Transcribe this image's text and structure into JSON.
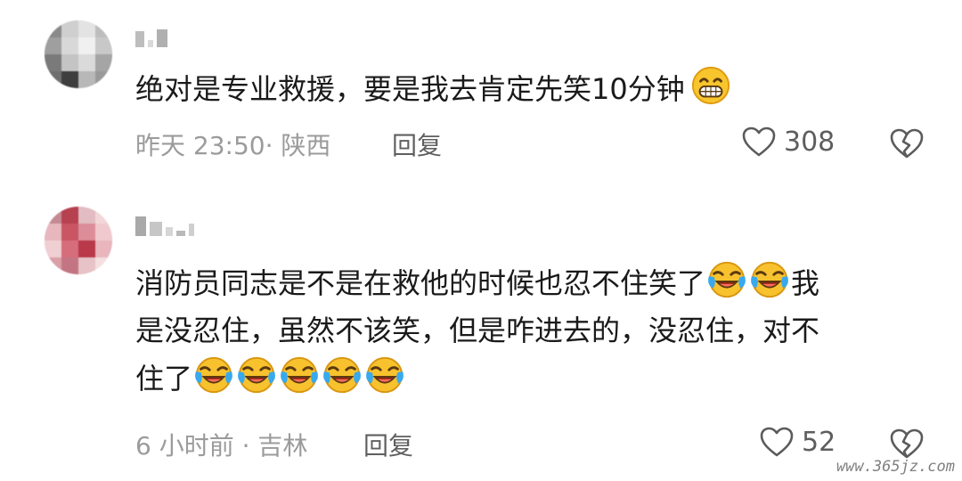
{
  "comments": [
    {
      "text_lines": [
        "绝对是专业救援，要是我去肯定先笑10分钟"
      ],
      "meta": "昨天 23:50· 陕西",
      "reply_label": "回复",
      "like_count": "308"
    },
    {
      "text_lines": [
        "消防员同志是不是在救他的时候也忍不住笑了",
        "我",
        "是没忍住，虽然不该笑，但是咋进去的，没忍住，对不",
        "住了"
      ],
      "meta": "6 小时前 · 吉林",
      "reply_label": "回复",
      "like_count": "52"
    }
  ],
  "icons": {
    "grin": "grinning-emoji",
    "laugh_cry": "rolling-laughing-emoji",
    "like": "heart-outline-icon",
    "dislike": "broken-heart-icon"
  },
  "colors": {
    "text": "#1a1a1a",
    "meta": "#9b9b9b",
    "emoji": "#f7c22e",
    "tears": "#35a7ea"
  },
  "watermark": "www.365jz.com"
}
